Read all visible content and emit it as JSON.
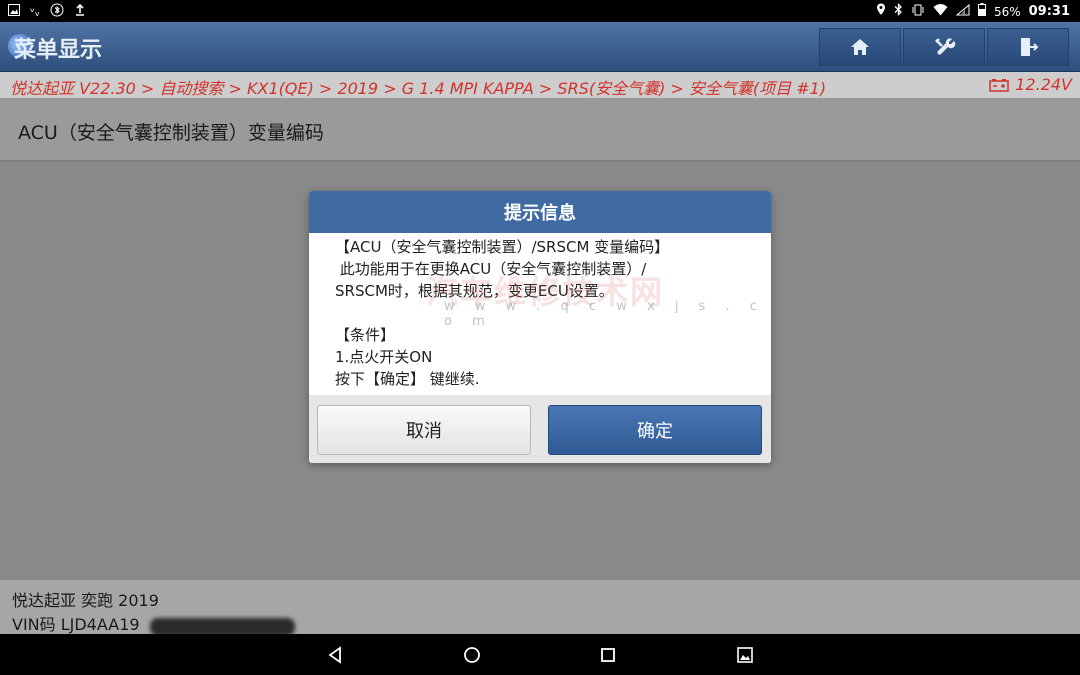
{
  "status_bar": {
    "battery": "56%",
    "time": "09:31"
  },
  "titlebar": {
    "title": "菜单显示",
    "icons": [
      "home-icon",
      "diagnose-tools-icon",
      "exit-icon"
    ]
  },
  "breadcrumb": {
    "path": "悦达起亚 V22.30 > 自动搜索 > KX1(QE) > 2019 > G 1.4 MPI KAPPA > SRS(安全气囊) > 安全气囊(项目 #1)",
    "voltage": "12.24V"
  },
  "header": {
    "title": "ACU（安全气囊控制装置）变量编码"
  },
  "dialog": {
    "title": "提示信息",
    "body": "【ACU（安全气囊控制装置）/SRSCM 变量编码】\n 此功能用于在更换ACU（安全气囊控制装置）/\nSRSCM时，根据其规范，变更ECU设置。\n\n【条件】\n1.点火开关ON\n按下【确定】 键继续.",
    "cancel_label": "取消",
    "ok_label": "确定",
    "watermark": "汽车维修技术网",
    "watermark_url": "w w w . q c w x j s . c o m"
  },
  "vehicle_info": {
    "model": "悦达起亚 奕跑 2019",
    "vin": "VIN码 LJD4AA19"
  },
  "colors": {
    "titlebar": "#3a5f91",
    "breadcrumb_text": "#d2332c",
    "dialog_header": "#3f6aa2",
    "ok_button": "#3a67a3"
  }
}
